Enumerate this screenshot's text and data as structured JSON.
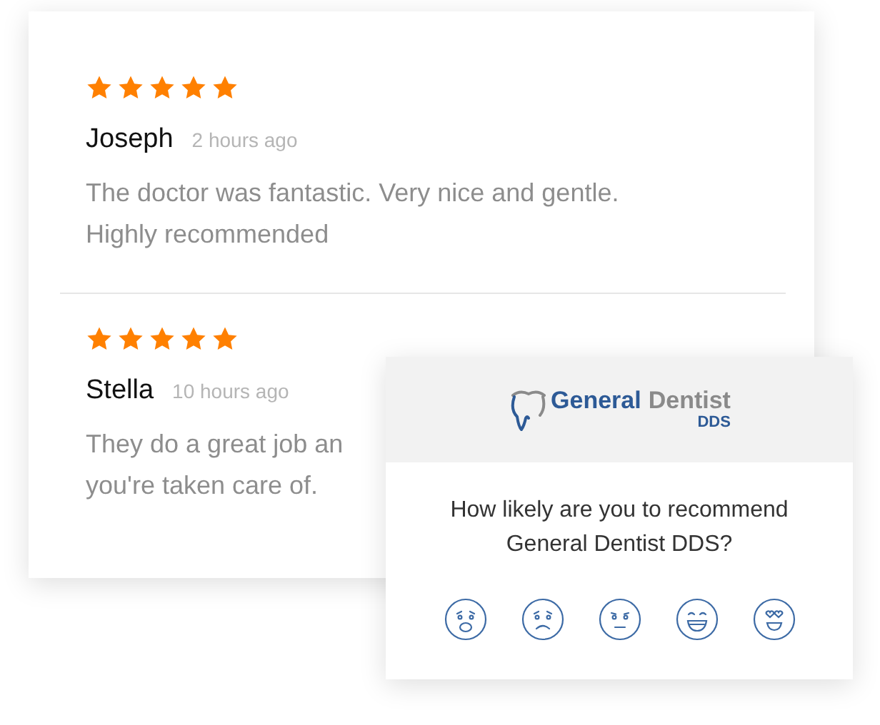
{
  "reviews": [
    {
      "stars": 5,
      "name": "Joseph",
      "time": "2 hours ago",
      "body": "The doctor was fantastic. Very nice and gentle.\nHighly recommended"
    },
    {
      "stars": 5,
      "name": "Stella",
      "time": "10 hours ago",
      "body": "They do a great job an\nyou're taken care of."
    }
  ],
  "survey": {
    "logo": {
      "primary": "General",
      "secondary": "Dentist",
      "suffix": "DDS"
    },
    "question": "How likely are you to recommend General Dentist DDS?",
    "faces": [
      {
        "kind": "terrified"
      },
      {
        "kind": "sad"
      },
      {
        "kind": "neutral"
      },
      {
        "kind": "happy"
      },
      {
        "kind": "love"
      }
    ]
  }
}
